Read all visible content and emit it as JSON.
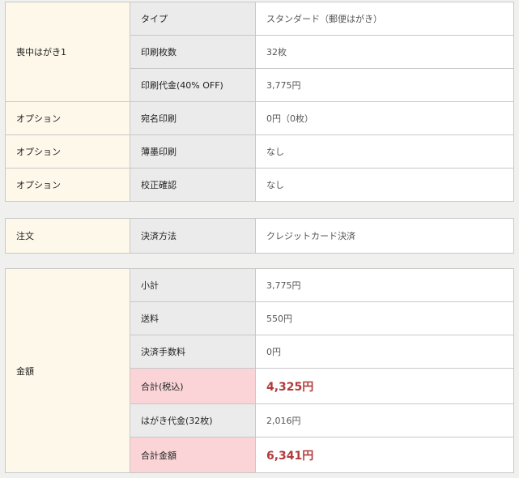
{
  "colors": {
    "group_bg": "#fdf8ea",
    "label_bg": "#ebebeb",
    "highlight_bg": "#fad4d6",
    "total_text": "#b23a3a",
    "border": "#c8c8c8"
  },
  "item": {
    "group_label": "喪中はがき1",
    "rows": [
      {
        "label": "タイプ",
        "value": "スタンダード（郵便はがき）"
      },
      {
        "label": "印刷枚数",
        "value": "32枚"
      },
      {
        "label": "印刷代金(40% OFF)",
        "value": "3,775円"
      }
    ]
  },
  "options": [
    {
      "group_label": "オプション",
      "label": "宛名印刷",
      "value": "0円（0枚）"
    },
    {
      "group_label": "オプション",
      "label": "薄墨印刷",
      "value": "なし"
    },
    {
      "group_label": "オプション",
      "label": "校正確認",
      "value": "なし"
    }
  ],
  "order": {
    "group_label": "注文",
    "label": "決済方法",
    "value": "クレジットカード決済"
  },
  "amount": {
    "group_label": "金額",
    "rows": [
      {
        "label": "小計",
        "value": "3,775円"
      },
      {
        "label": "送料",
        "value": "550円"
      },
      {
        "label": "決済手数料",
        "value": "0円"
      },
      {
        "label": "合計(税込)",
        "value": "4,325円"
      },
      {
        "label": "はがき代金(32枚)",
        "value": "2,016円"
      },
      {
        "label": "合計金額",
        "value": "6,341円"
      }
    ]
  }
}
